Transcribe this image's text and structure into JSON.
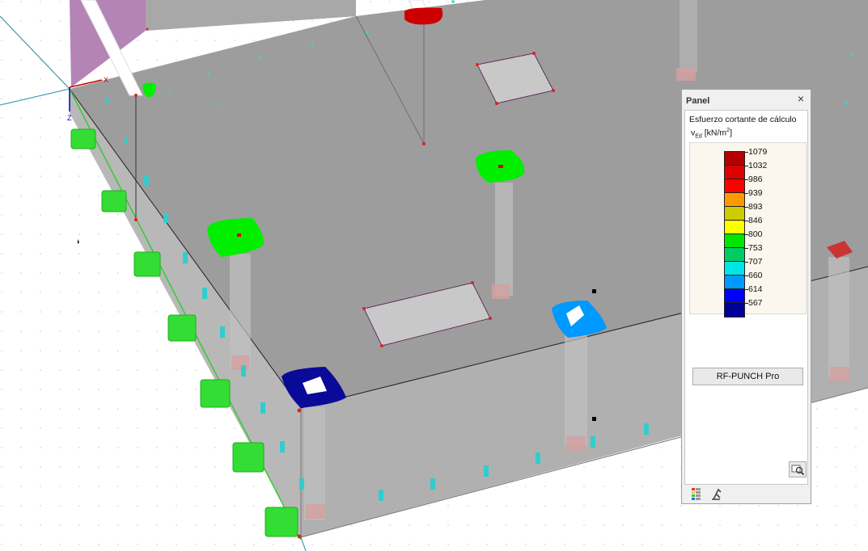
{
  "axes": {
    "x_label": "X",
    "z_label": "Z"
  },
  "panel": {
    "title": "Panel",
    "close_glyph": "×",
    "legend_heading": "Esfuerzo cortante de cálculo",
    "legend_symbol": {
      "symbol": "v",
      "subscript": "Ed",
      "unit_prefix": "[kN/m",
      "unit_power": "2",
      "unit_suffix": "]"
    },
    "legend": [
      {
        "value": "1079",
        "color": "#b40000"
      },
      {
        "value": "1032",
        "color": "#dc0000"
      },
      {
        "value": "986",
        "color": "#ff0000"
      },
      {
        "value": "939",
        "color": "#ff9900"
      },
      {
        "value": "893",
        "color": "#cccc00"
      },
      {
        "value": "846",
        "color": "#ffff00"
      },
      {
        "value": "800",
        "color": "#00e600"
      },
      {
        "value": "753",
        "color": "#00cc66"
      },
      {
        "value": "707",
        "color": "#00e6e6"
      },
      {
        "value": "660",
        "color": "#0099ff"
      },
      {
        "value": "614",
        "color": "#0000ff"
      },
      {
        "value": "567",
        "color": "#000099"
      }
    ],
    "module_button": "RF-PUNCH Pro",
    "tabs": [
      {
        "icon": "color-scale-icon"
      },
      {
        "icon": "display-settings-icon"
      }
    ]
  },
  "colors": {
    "slab": "#9b9b9b",
    "wall": "#a8a8a8",
    "support": "#44dd44",
    "opening_outline": "#e060e0"
  }
}
